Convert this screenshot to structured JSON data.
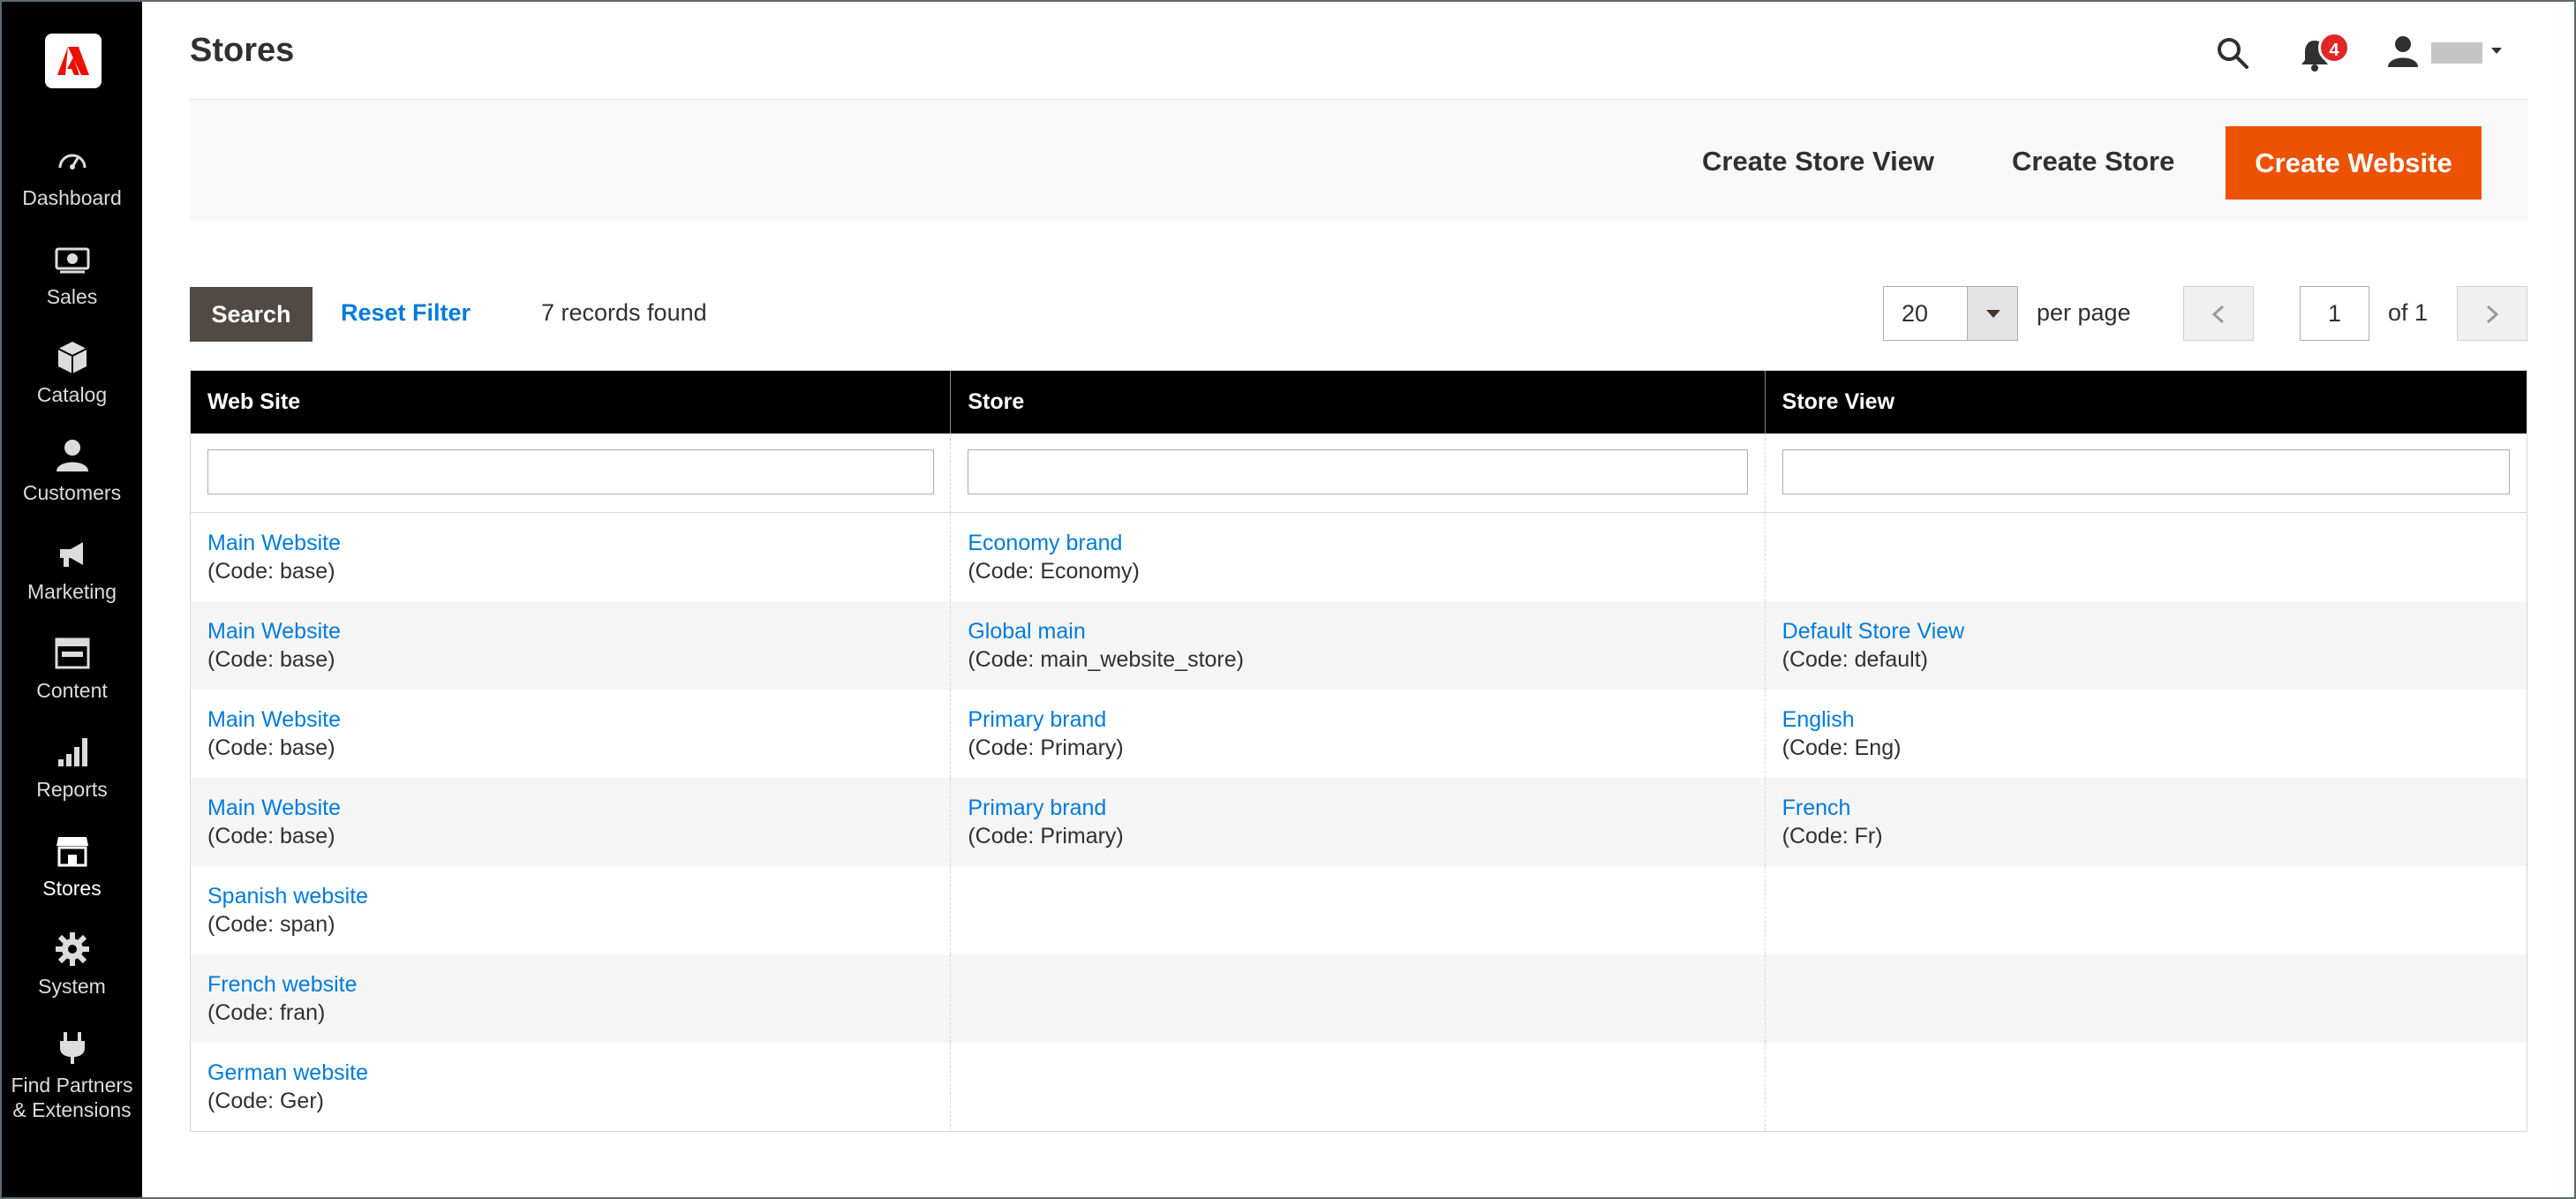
{
  "header": {
    "title": "Stores",
    "notifications_count": "4"
  },
  "sidebar": {
    "items": [
      {
        "label": "Dashboard",
        "icon": "dashboard-icon"
      },
      {
        "label": "Sales",
        "icon": "sales-icon"
      },
      {
        "label": "Catalog",
        "icon": "catalog-icon"
      },
      {
        "label": "Customers",
        "icon": "customers-icon"
      },
      {
        "label": "Marketing",
        "icon": "marketing-icon"
      },
      {
        "label": "Content",
        "icon": "content-icon"
      },
      {
        "label": "Reports",
        "icon": "reports-icon"
      },
      {
        "label": "Stores",
        "icon": "stores-icon",
        "active": true
      },
      {
        "label": "System",
        "icon": "system-icon"
      },
      {
        "label": "Find Partners",
        "label2": "& Extensions",
        "icon": "partners-icon"
      }
    ]
  },
  "actions": {
    "create_store_view": "Create Store View",
    "create_store": "Create Store",
    "create_website": "Create Website"
  },
  "controls": {
    "search": "Search",
    "reset_filter": "Reset Filter",
    "records_found": "7 records found",
    "per_page_value": "20",
    "per_page_label": "per page",
    "page_current": "1",
    "page_of": "of 1"
  },
  "colors": {
    "accent": "#eb5202",
    "link": "#007bdb",
    "sidebar_bg": "#000000",
    "badge": "#e22626"
  },
  "table": {
    "columns": [
      "Web Site",
      "Store",
      "Store View"
    ],
    "rows": [
      {
        "website": "Main Website",
        "website_code": "(Code: base)",
        "store": "Economy brand",
        "store_code": "(Code: Economy)",
        "view": "",
        "view_code": ""
      },
      {
        "website": "Main Website",
        "website_code": "(Code: base)",
        "store": "Global main",
        "store_code": "(Code: main_website_store)",
        "view": "Default Store View",
        "view_code": "(Code: default)"
      },
      {
        "website": "Main Website",
        "website_code": "(Code: base)",
        "store": "Primary brand",
        "store_code": "(Code: Primary)",
        "view": "English",
        "view_code": "(Code: Eng)"
      },
      {
        "website": "Main Website",
        "website_code": "(Code: base)",
        "store": "Primary brand",
        "store_code": "(Code: Primary)",
        "view": "French",
        "view_code": "(Code: Fr)"
      },
      {
        "website": "Spanish website",
        "website_code": "(Code: span)",
        "store": "",
        "store_code": "",
        "view": "",
        "view_code": ""
      },
      {
        "website": "French website",
        "website_code": "(Code: fran)",
        "store": "",
        "store_code": "",
        "view": "",
        "view_code": ""
      },
      {
        "website": "German website",
        "website_code": "(Code: Ger)",
        "store": "",
        "store_code": "",
        "view": "",
        "view_code": ""
      }
    ]
  }
}
